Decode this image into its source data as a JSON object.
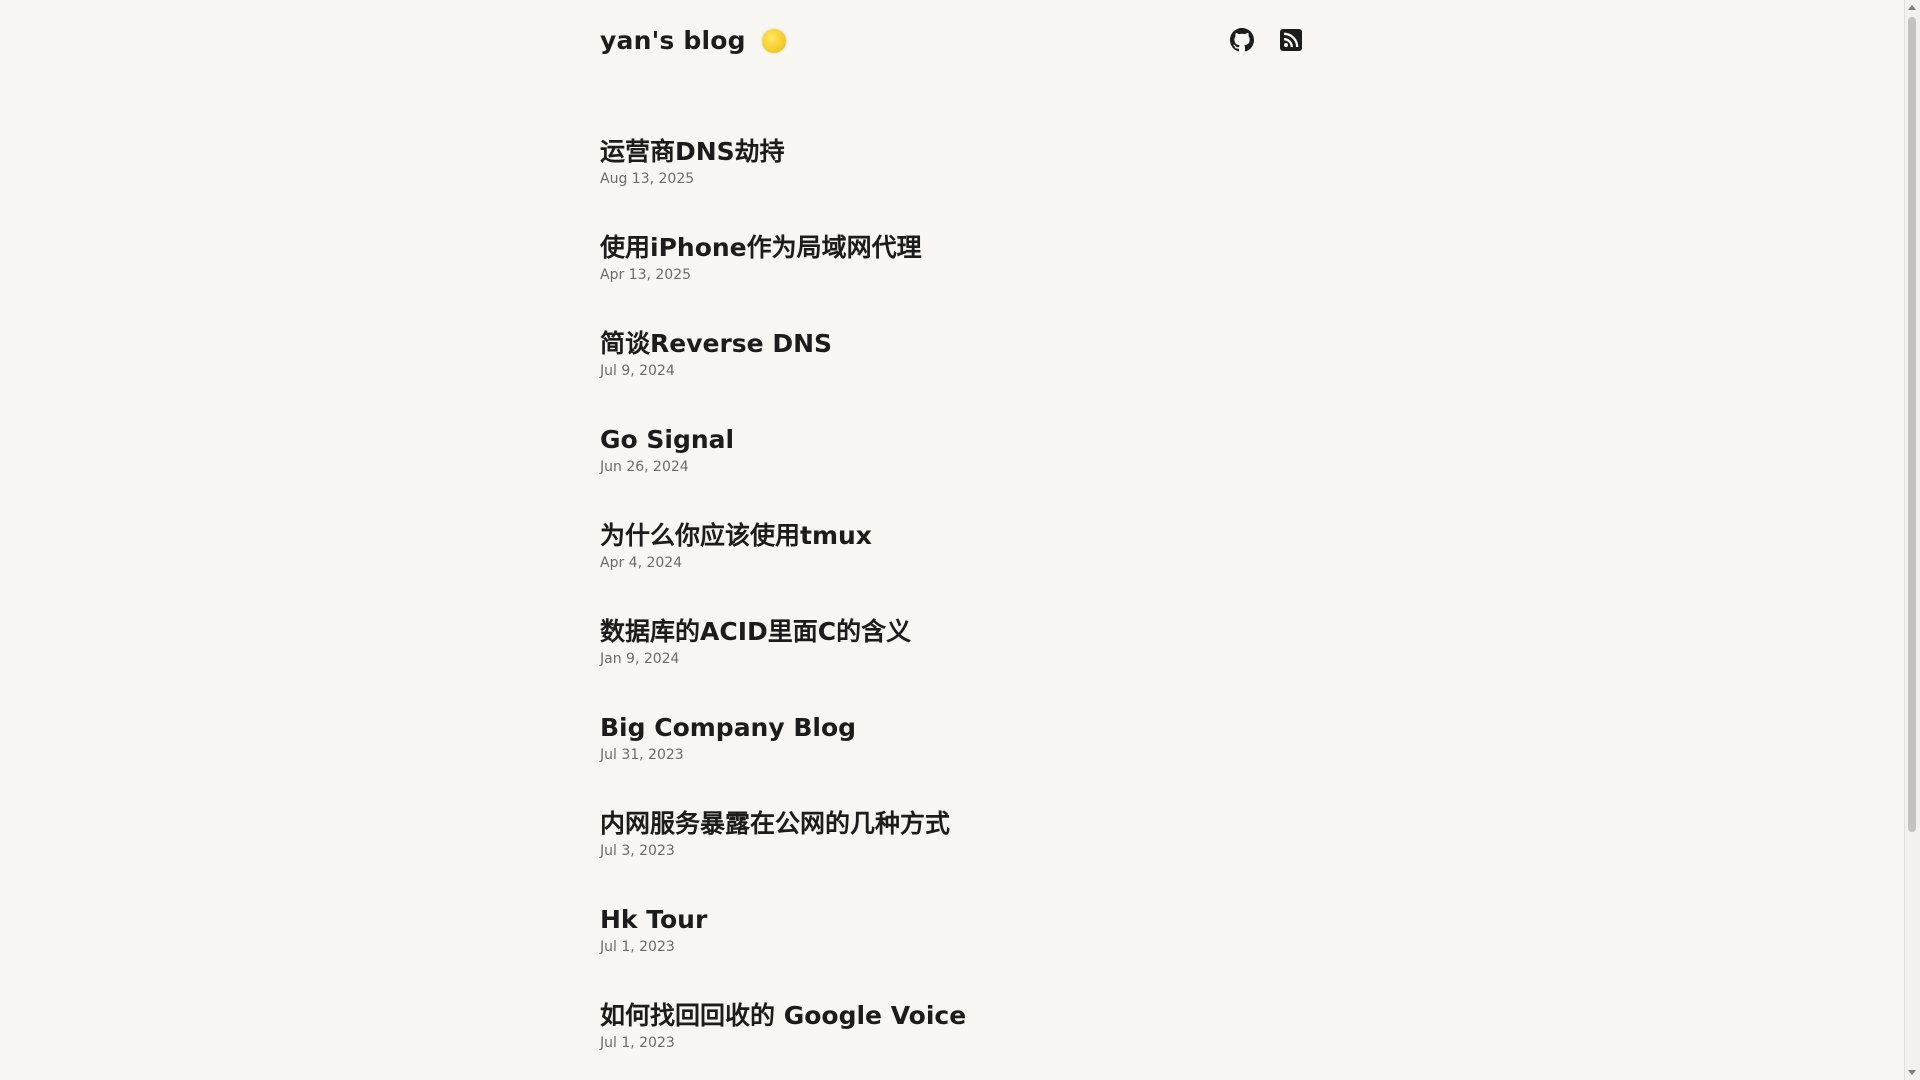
{
  "site": {
    "title": "yan's blog",
    "theme_toggle_icon": "sun-icon",
    "links": [
      {
        "name": "github",
        "icon": "github-icon"
      },
      {
        "name": "rss",
        "icon": "rss-icon"
      }
    ]
  },
  "posts": [
    {
      "title": "运营商DNS劫持",
      "date": "Aug 13, 2025"
    },
    {
      "title": "使用iPhone作为局域网代理",
      "date": "Apr 13, 2025"
    },
    {
      "title": "简谈Reverse DNS",
      "date": "Jul 9, 2024"
    },
    {
      "title": "Go Signal",
      "date": "Jun 26, 2024"
    },
    {
      "title": "为什么你应该使用tmux",
      "date": "Apr 4, 2024"
    },
    {
      "title": "数据库的ACID里面C的含义",
      "date": "Jan 9, 2024"
    },
    {
      "title": "Big Company Blog",
      "date": "Jul 31, 2023"
    },
    {
      "title": "内网服务暴露在公网的几种方式",
      "date": "Jul 3, 2023"
    },
    {
      "title": "Hk Tour",
      "date": "Jul 1, 2023"
    },
    {
      "title": "如何找回回收的 Google Voice",
      "date": "Jul 1, 2023"
    }
  ],
  "colors": {
    "background": "#f8f6f2",
    "text": "#1c1c1c",
    "muted": "#6b6b6b",
    "sun": "#f6cf2d"
  }
}
